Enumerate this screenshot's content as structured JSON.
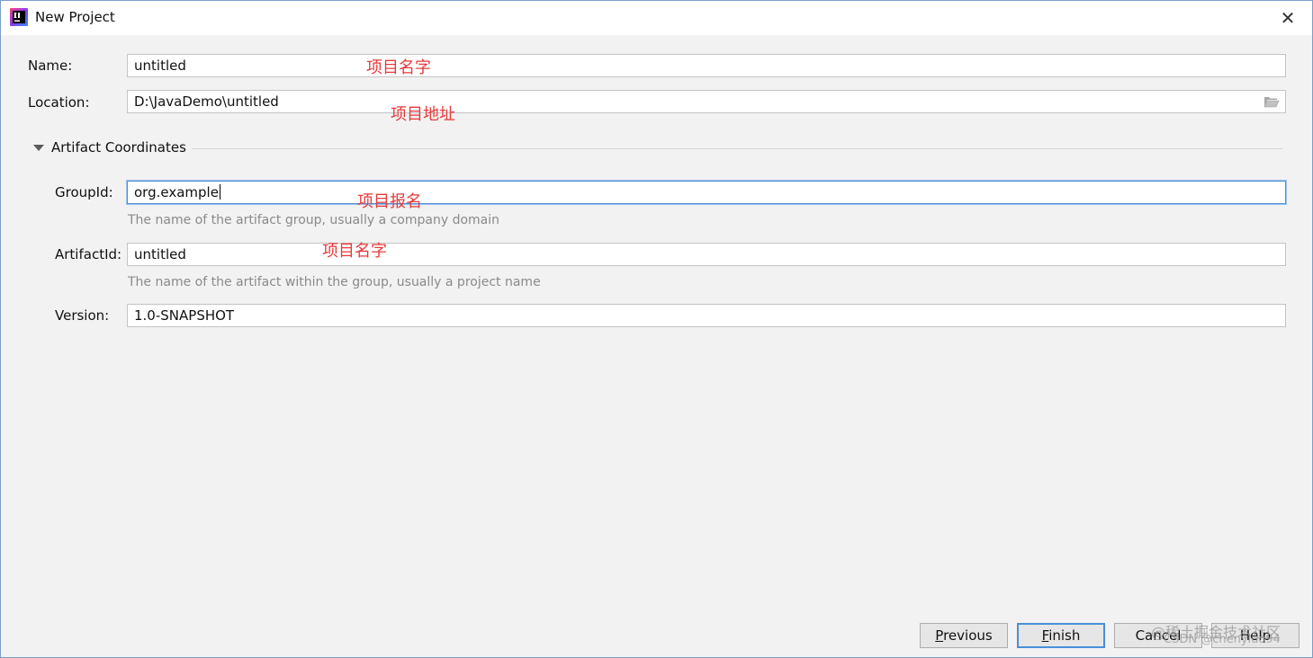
{
  "window": {
    "title": "New Project"
  },
  "form": {
    "name": {
      "label": "Name:",
      "value": "untitled"
    },
    "location": {
      "label": "Location:",
      "value": "D:\\JavaDemo\\untitled"
    },
    "section": {
      "label": "Artifact Coordinates"
    },
    "group_id": {
      "label": "GroupId:",
      "value": "org.example",
      "hint": "The name of the artifact group, usually a company domain"
    },
    "artifact_id": {
      "label": "ArtifactId:",
      "value": "untitled",
      "hint": "The name of the artifact within the group, usually a project name"
    },
    "version": {
      "label": "Version:",
      "value": "1.0-SNAPSHOT"
    }
  },
  "annotations": {
    "name": "项目名字",
    "location": "项目地址",
    "group_id": "项目报名",
    "artifact_id": "项目名字"
  },
  "buttons": {
    "previous": {
      "mnemonic": "P",
      "rest": "revious"
    },
    "finish": {
      "mnemonic": "F",
      "rest": "inish"
    },
    "cancel": "Cancel",
    "help": "Help"
  },
  "watermarks": {
    "juejin": "@稀土掘金技术社区",
    "csdn": "CSDN @chenyluo94"
  },
  "colors": {
    "accent": "#4a8fd8",
    "annotation": "#e63a3a",
    "background": "#f2f2f2"
  },
  "icons": [
    "intellij-app-icon",
    "close-icon",
    "folder-icon",
    "collapse-triangle-icon"
  ]
}
